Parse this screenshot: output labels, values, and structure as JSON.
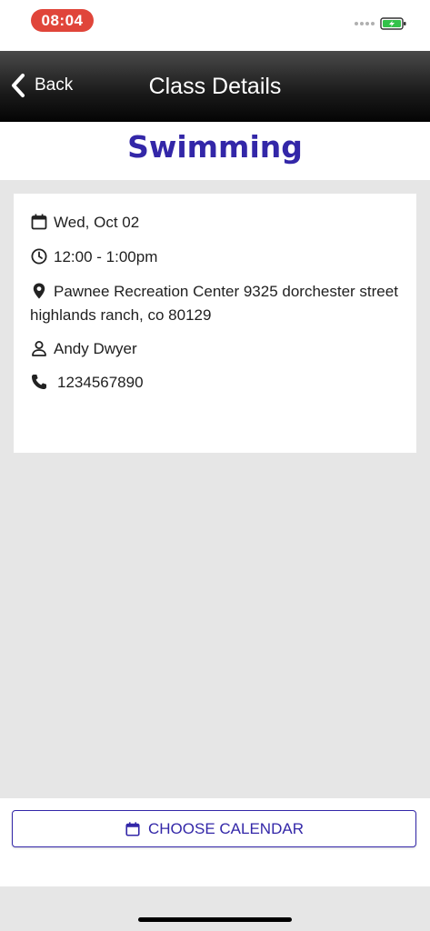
{
  "status_bar": {
    "time": "08:04",
    "battery_color": "#33c24a"
  },
  "nav": {
    "back_label": "Back",
    "title": "Class Details"
  },
  "class": {
    "name": "Swimming",
    "date": "Wed, Oct 02",
    "time": "12:00 - 1:00pm",
    "location": "Pawnee Recreation Center 9325 dorchester street highlands ranch, co 80129",
    "instructor": "Andy Dwyer",
    "phone": "1234567890"
  },
  "actions": {
    "choose_calendar_label": "CHOOSE CALENDAR"
  },
  "colors": {
    "accent": "#3327a8",
    "background": "#e6e6e6",
    "status_time_bg": "#e0453a"
  },
  "icons": {
    "date": "calendar-icon",
    "time": "clock-icon",
    "location": "map-pin-icon",
    "instructor": "person-icon",
    "phone": "phone-icon",
    "back": "chevron-left-icon"
  }
}
